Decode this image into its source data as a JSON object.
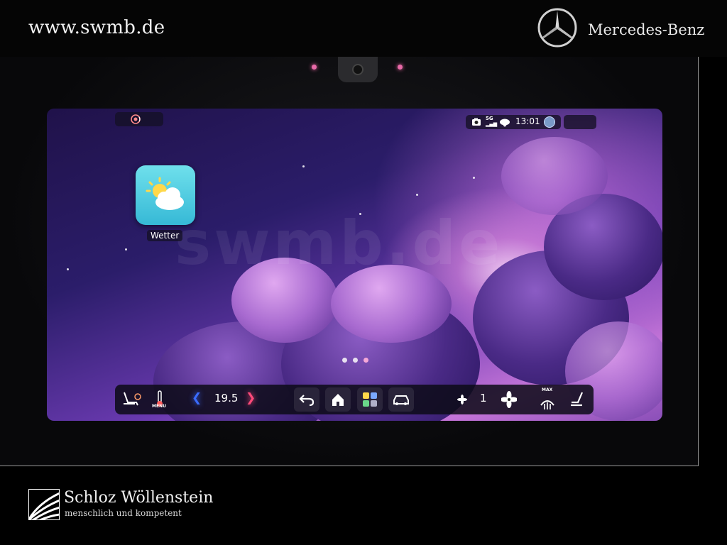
{
  "header": {
    "site_url": "www.swmb.de",
    "brand_name": "Mercedes-Benz"
  },
  "footer": {
    "dealer_name": "Schloz Wöllenstein",
    "dealer_tagline": "menschlich und kompetent"
  },
  "screen": {
    "watermark": "swmb.de",
    "status_bar": {
      "time": "13:01",
      "network": "5G",
      "icons": [
        "camera-icon",
        "5g-icon",
        "cloud-icon",
        "profile-avatar"
      ]
    },
    "app": {
      "label": "Wetter",
      "icon": "weather-icon"
    },
    "page_dots": {
      "count": 3,
      "active_index": 2
    },
    "dock": {
      "temperature": "19.5",
      "menu_label": "MENU",
      "fan_level": "1",
      "max_label": "MAX",
      "icons": [
        "seat-climate-icon",
        "thermometer-icon",
        "chevron-left-icon",
        "chevron-right-icon",
        "back-icon",
        "home-icon",
        "apps-grid-icon",
        "car-icon",
        "fan-small-icon",
        "fan-large-icon",
        "defrost-icon",
        "seat-icon"
      ]
    }
  },
  "colors": {
    "accent_blue": "#3a6cff",
    "accent_red": "#ff4a7a",
    "weather_tile": "#36b9d6"
  }
}
